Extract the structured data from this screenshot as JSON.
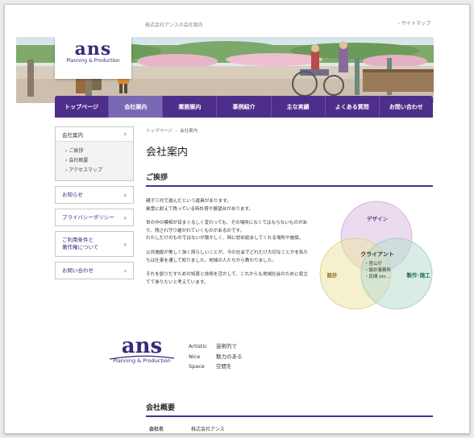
{
  "header": {
    "tagline": "株式会社アンスの会社案内",
    "sitemap_label": "サイトマップ",
    "logo_main": "ans",
    "logo_sub": "Planning & Production"
  },
  "nav": {
    "items": [
      "トップページ",
      "会社案内",
      "業務案内",
      "事例紹介",
      "主な実績",
      "よくある質問",
      "お問い合わせ"
    ],
    "active_index": 1
  },
  "sidebar": {
    "company_label": "会社案内",
    "sub_items": [
      "ご挨拶",
      "会社概要",
      "アクセスマップ"
    ],
    "links": [
      "お知らせ",
      "プライバシーポリシー",
      "ご利用条件と\n著作権について",
      "お問い合わせ"
    ]
  },
  "main": {
    "breadcrumb_home": "トップページ",
    "breadcrumb_current": "会社案内",
    "title": "会社案内",
    "greeting_title": "ご挨拶",
    "paragraphs": [
      "親子三代で遊んだという遊具があります。\n風雪に耐えて残っている時計塔や展望台があります。",
      "世の中の模相が目まぐるしく変わっても、その場所になくてはならないものがあり、残され守り継がれていくものがあるのです。\nわたしだけのものではないが懐かしく、時に慰め励ましてくれる場所や施設。",
      "公共施設が美しく強く誇らしいことが、今の社会でどれだけ大切なことかを私たちは仕事を通して知りました。地域の人たちから教わりました。",
      "それを創りだすための知恵と技術を活かして、これからも地域社会のために役立てて参りたいと考えています。"
    ],
    "venn": {
      "design": "デザイン",
      "plan": "設計",
      "build": "製作･施工",
      "client_title": "クライアント",
      "client_items": [
        "・官公庁",
        "・設計事務所",
        "・民間 etc..."
      ]
    },
    "motto": [
      {
        "en": "Artistic",
        "jp": "芸術的で"
      },
      {
        "en": "Nice",
        "jp": "魅力のある"
      },
      {
        "en": "Space",
        "jp": "空間を"
      }
    ],
    "overview_title": "会社概要",
    "overview_rows": [
      {
        "key": "会社名",
        "value": "株式会社アンス"
      }
    ]
  },
  "colors": {
    "brand_purple": "#4d2e8a",
    "nav_active": "#7a68b4",
    "venn_design": "#d8bde0",
    "venn_plan": "#ede3a6",
    "venn_build": "#b9ddd0"
  }
}
